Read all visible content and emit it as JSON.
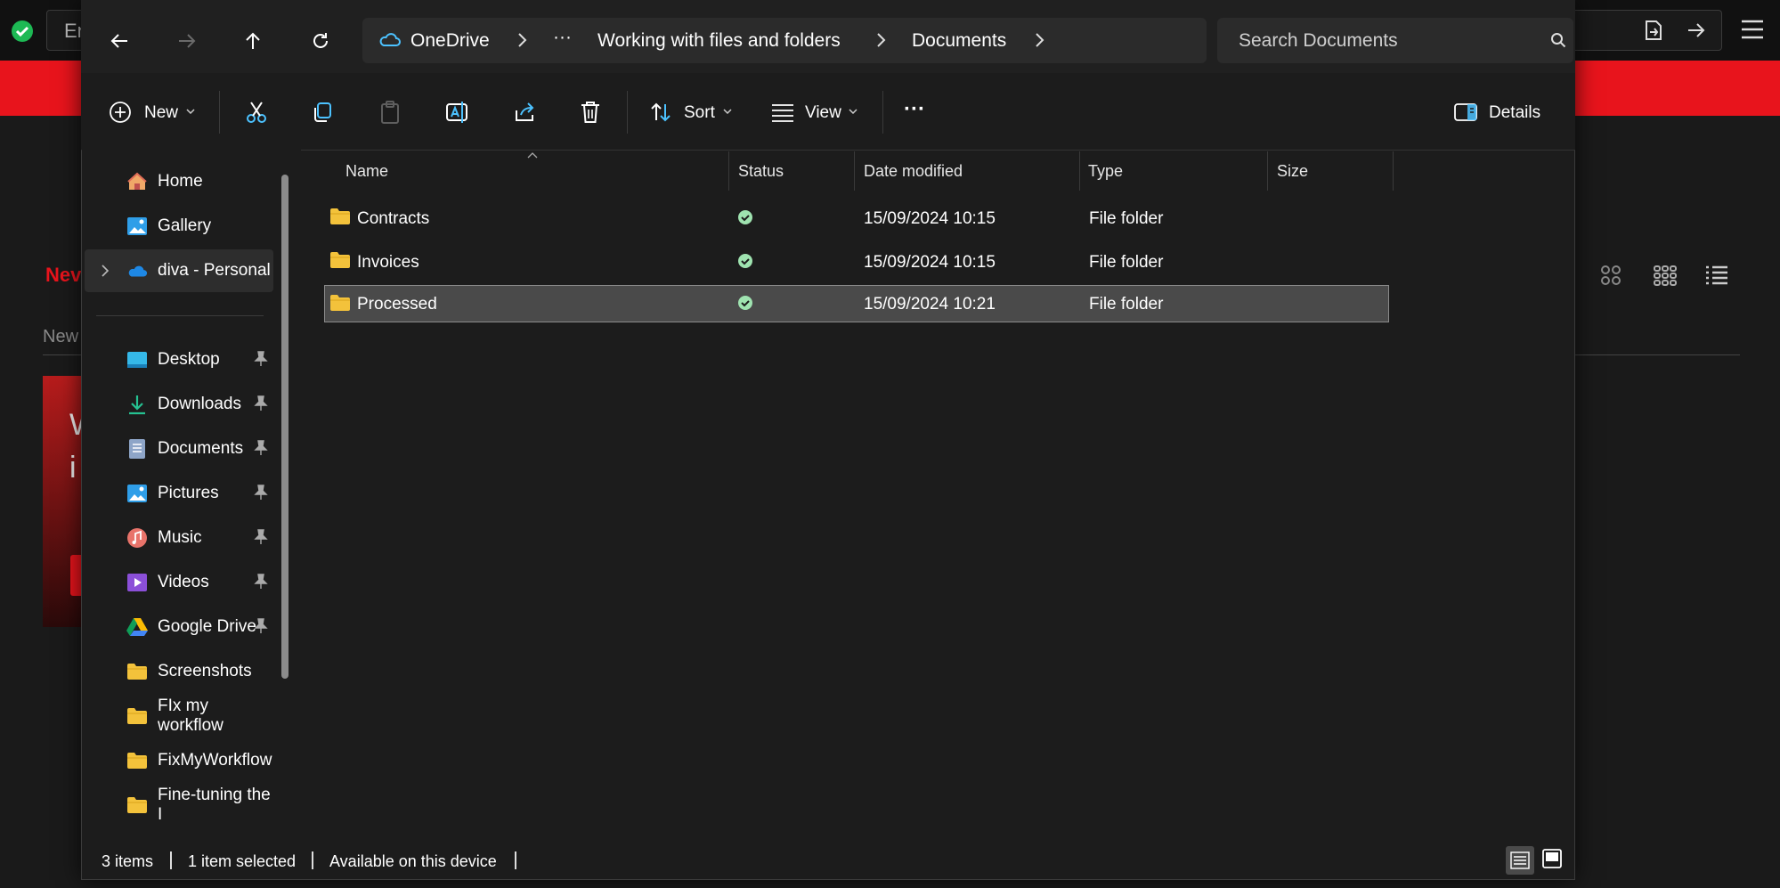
{
  "background_browser": {
    "url_placeholder": "En",
    "heading_fragment": "Nev",
    "subheading_fragment": "New",
    "card_text_1": "W",
    "card_text_2": "i",
    "brand_color": "#e8141c"
  },
  "address_bar": {
    "root": "OneDrive",
    "ellipsis": "···",
    "crumbs": [
      "Working with files and folders",
      "Documents"
    ]
  },
  "search": {
    "placeholder": "Search Documents"
  },
  "command_bar": {
    "new_label": "New",
    "sort_label": "Sort",
    "view_label": "View",
    "details_label": "Details",
    "more_label": "···"
  },
  "sidebar": {
    "top_items": [
      {
        "label": "Home",
        "icon": "home-icon"
      },
      {
        "label": "Gallery",
        "icon": "gallery-icon"
      },
      {
        "label": "diva - Personal",
        "icon": "onedrive-cloud-icon"
      }
    ],
    "quick_access": [
      {
        "label": "Desktop",
        "icon": "desktop-icon",
        "pinned": true
      },
      {
        "label": "Downloads",
        "icon": "downloads-icon",
        "pinned": true
      },
      {
        "label": "Documents",
        "icon": "documents-icon",
        "pinned": true
      },
      {
        "label": "Pictures",
        "icon": "pictures-icon",
        "pinned": true
      },
      {
        "label": "Music",
        "icon": "music-icon",
        "pinned": true
      },
      {
        "label": "Videos",
        "icon": "videos-icon",
        "pinned": true
      },
      {
        "label": "Google Drive",
        "icon": "google-drive-icon",
        "pinned": true
      },
      {
        "label": "Screenshots",
        "icon": "folder-icon",
        "pinned": false
      },
      {
        "label": "FIx my workflow",
        "icon": "folder-icon",
        "pinned": false
      },
      {
        "label": "FixMyWorkflow",
        "icon": "folder-icon",
        "pinned": false
      },
      {
        "label": "Fine-tuning the I",
        "icon": "folder-icon",
        "pinned": false
      }
    ]
  },
  "file_list": {
    "columns": [
      "Name",
      "Status",
      "Date modified",
      "Type",
      "Size"
    ],
    "rows": [
      {
        "name": "Contracts",
        "status": "synced",
        "date": "15/09/2024 10:15",
        "type": "File folder",
        "size": ""
      },
      {
        "name": "Invoices",
        "status": "synced",
        "date": "15/09/2024 10:15",
        "type": "File folder",
        "size": ""
      },
      {
        "name": "Processed",
        "status": "synced",
        "date": "15/09/2024 10:21",
        "type": "File folder",
        "size": "",
        "selected": true
      }
    ]
  },
  "status_bar": {
    "items_count": "3 items",
    "selection": "1 item selected",
    "availability": "Available on this device"
  },
  "colors": {
    "folder": "#f3c23b",
    "sync_ok": "#9fe3b0",
    "accent_blue": "#4cc2ff"
  }
}
